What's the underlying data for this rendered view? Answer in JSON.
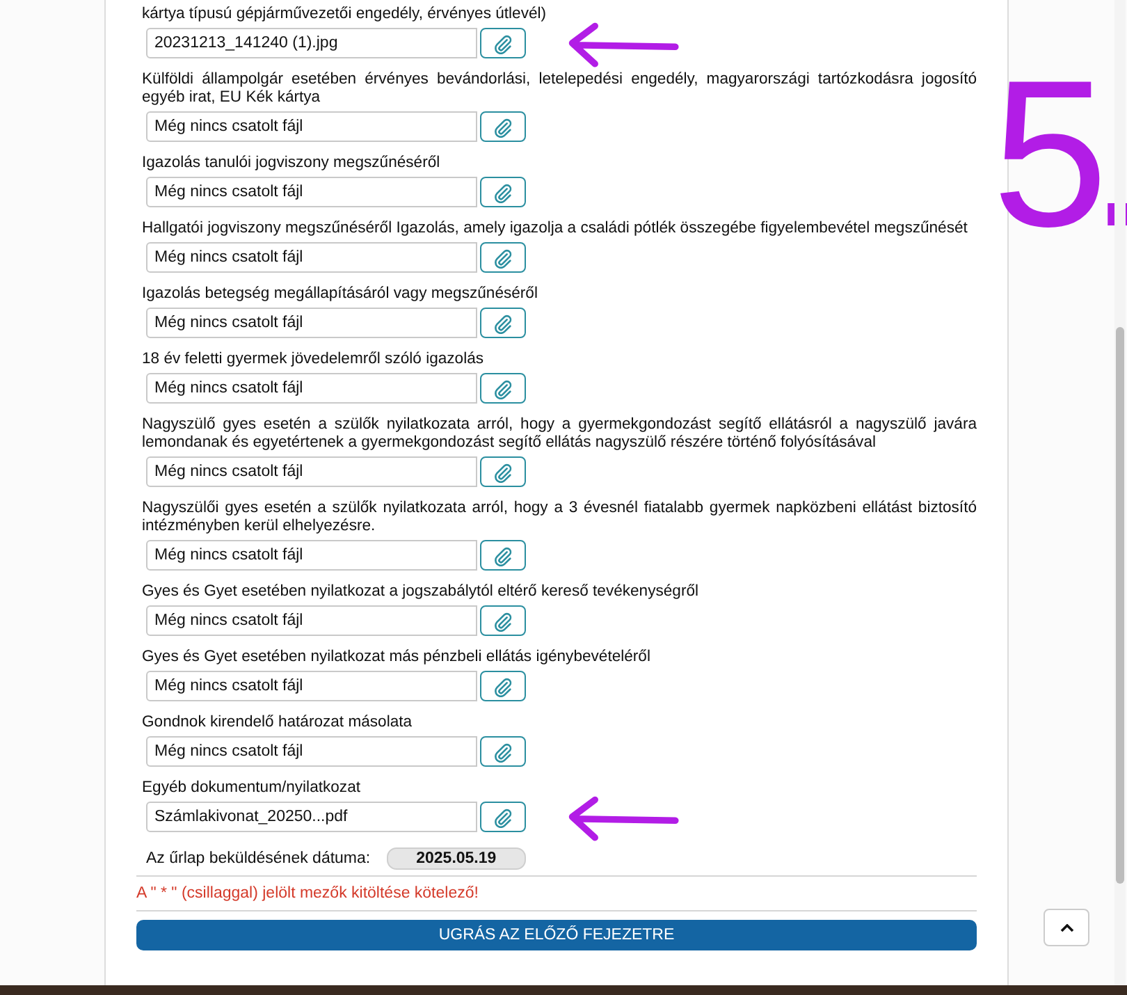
{
  "documents": [
    {
      "label": "kártya típusú gépjárművezetői engedély, érvényes útlevél)",
      "file_text": "20231213_141240 (1).jpg",
      "marked": true
    },
    {
      "label": "Külföldi állampolgár esetében érvényes bevándorlási, letelepedési engedély, magyarországi tartózkodásra jogosító egyéb irat, EU Kék kártya",
      "file_text": "Még nincs csatolt fájl",
      "marked": false
    },
    {
      "label": "Igazolás tanulói jogviszony megszűnéséről",
      "file_text": "Még nincs csatolt fájl",
      "marked": false
    },
    {
      "label": "Hallgatói jogviszony megszűnéséről Igazolás, amely igazolja a családi pótlék összegébe figyelembevétel megszűnését",
      "file_text": "Még nincs csatolt fájl",
      "marked": false
    },
    {
      "label": "Igazolás betegség megállapításáról vagy megszűnéséről",
      "file_text": "Még nincs csatolt fájl",
      "marked": false
    },
    {
      "label": "18 év feletti gyermek jövedelemről szóló igazolás",
      "file_text": "Még nincs csatolt fájl",
      "marked": false
    },
    {
      "label": "Nagyszülő gyes esetén a szülők nyilatkozata arról, hogy a gyermekgondozást segítő ellátásról a nagyszülő javára lemondanak és egyetértenek a gyermekgondozást segítő ellátás nagyszülő részére történő folyósításával",
      "file_text": "Még nincs csatolt fájl",
      "marked": false
    },
    {
      "label": "Nagyszülői gyes esetén a szülők nyilatkozata arról, hogy a 3 évesnél fiatalabb gyermek napközbeni ellátást biztosító intézményben kerül elhelyezésre.",
      "file_text": "Még nincs csatolt fájl",
      "marked": false
    },
    {
      "label": "Gyes és Gyet esetében nyilatkozat a jogszabálytól eltérő kereső tevékenységről",
      "file_text": "Még nincs csatolt fájl",
      "marked": false
    },
    {
      "label": "Gyes és Gyet esetében nyilatkozat más pénzbeli ellátás igénybevételéről",
      "file_text": "Még nincs csatolt fájl",
      "marked": false
    },
    {
      "label": "Gondnok kirendelő határozat másolata",
      "file_text": "Még nincs csatolt fájl",
      "marked": false
    },
    {
      "label": "Egyéb dokumentum/nyilatkozat",
      "file_text": "Számlakivonat_20250...pdf",
      "marked": true
    }
  ],
  "submission_date": {
    "label": "Az űrlap beküldésének dátuma:",
    "value": "2025.05.19"
  },
  "required_note": "A \" * \" (csillaggal) jelölt mezők kitöltése kötelező!",
  "prev_chapter_button": "UGRÁS AZ ELŐZŐ FEJEZETRE",
  "annotation_text": "5."
}
